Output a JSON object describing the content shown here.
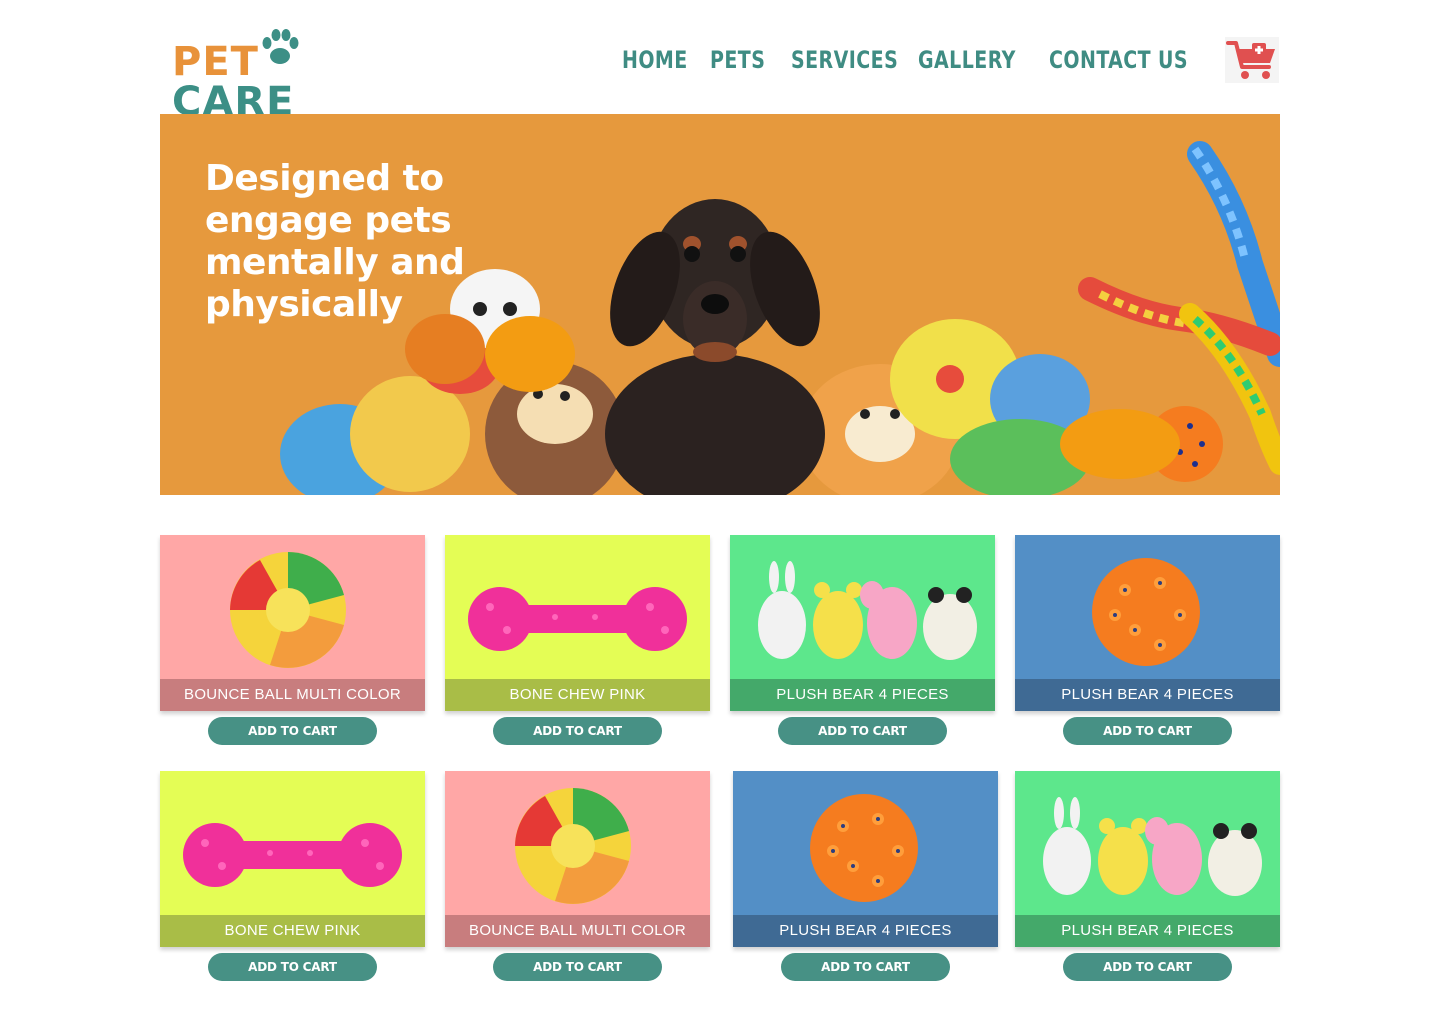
{
  "brand": {
    "pet": "PET",
    "care": "CARE"
  },
  "nav": {
    "items": [
      {
        "label": "HOME"
      },
      {
        "label": "PETS"
      },
      {
        "label": "SERVICES"
      },
      {
        "label": "GALLERY"
      },
      {
        "label": "CONTACT US"
      }
    ]
  },
  "cart_icon": "shopping-cart-plus-icon",
  "hero": {
    "title": "Designed to engage pets mentally and physically"
  },
  "products": [
    {
      "name": "BOUNCE BALL MULTI COLOR",
      "button": "ADD TO CART",
      "color": "#ffa7a6",
      "image": "multicolor-ball-icon"
    },
    {
      "name": "BONE CHEW PINK",
      "button": "ADD TO CART",
      "color": "#e4fd55",
      "image": "pink-bone-icon"
    },
    {
      "name": "PLUSH BEAR 4 PIECES",
      "button": "ADD TO CART",
      "color": "#5de78c",
      "image": "plush-animals-icon"
    },
    {
      "name": "PLUSH BEAR 4 PIECES",
      "button": "ADD TO CART",
      "color": "#538fc6",
      "image": "spiky-orange-ball-icon"
    },
    {
      "name": "BONE CHEW PINK",
      "button": "ADD TO CART",
      "color": "#e4fd55",
      "image": "pink-bone-icon"
    },
    {
      "name": "BOUNCE BALL MULTI COLOR",
      "button": "ADD TO CART",
      "color": "#ffa7a6",
      "image": "multicolor-ball-icon"
    },
    {
      "name": "PLUSH BEAR 4 PIECES",
      "button": "ADD TO CART",
      "color": "#538fc6",
      "image": "spiky-orange-ball-icon"
    },
    {
      "name": "PLUSH BEAR 4 PIECES",
      "button": "ADD TO CART",
      "color": "#5de78c",
      "image": "plush-animals-icon"
    }
  ],
  "colors": {
    "accent": "#479185",
    "hero_bg": "#e6993d",
    "logo_orange": "#e8923a",
    "logo_teal": "#3c8f86"
  }
}
